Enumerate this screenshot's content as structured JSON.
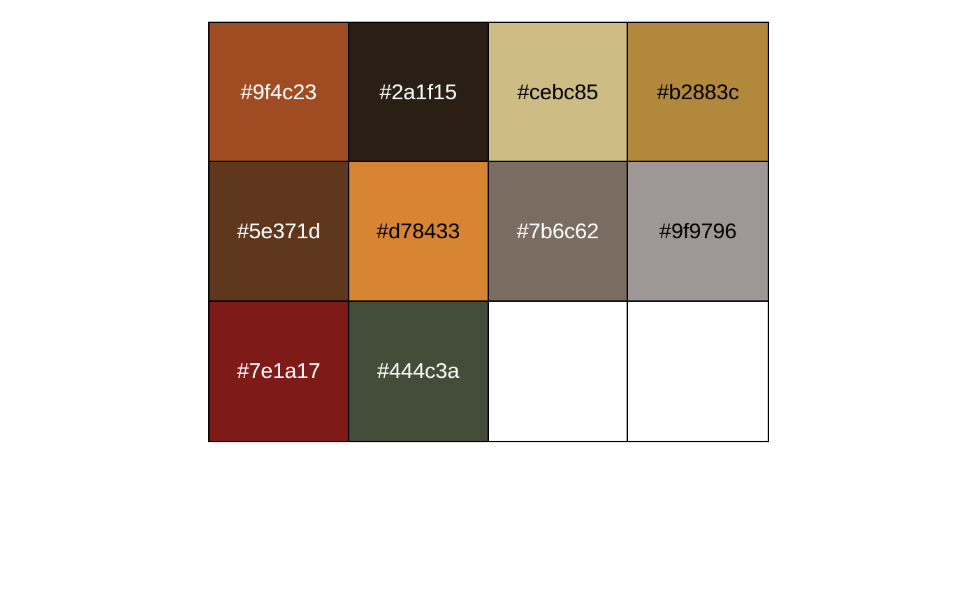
{
  "palette": {
    "columns": 4,
    "rows": 3,
    "swatches": [
      {
        "hex": "#9f4c23",
        "label": "#9f4c23",
        "text_color": "#ffffff"
      },
      {
        "hex": "#2a1f15",
        "label": "#2a1f15",
        "text_color": "#ffffff"
      },
      {
        "hex": "#cebc85",
        "label": "#cebc85",
        "text_color": "#000000"
      },
      {
        "hex": "#b2883c",
        "label": "#b2883c",
        "text_color": "#000000"
      },
      {
        "hex": "#5e371d",
        "label": "#5e371d",
        "text_color": "#ffffff"
      },
      {
        "hex": "#d78433",
        "label": "#d78433",
        "text_color": "#000000"
      },
      {
        "hex": "#7b6c62",
        "label": "#7b6c62",
        "text_color": "#ffffff"
      },
      {
        "hex": "#9f9796",
        "label": "#9f9796",
        "text_color": "#000000"
      },
      {
        "hex": "#7e1a17",
        "label": "#7e1a17",
        "text_color": "#ffffff"
      },
      {
        "hex": "#444c3a",
        "label": "#444c3a",
        "text_color": "#ffffff"
      },
      {
        "hex": "#ffffff",
        "label": "",
        "text_color": "#000000"
      },
      {
        "hex": "#ffffff",
        "label": "",
        "text_color": "#000000"
      }
    ]
  }
}
